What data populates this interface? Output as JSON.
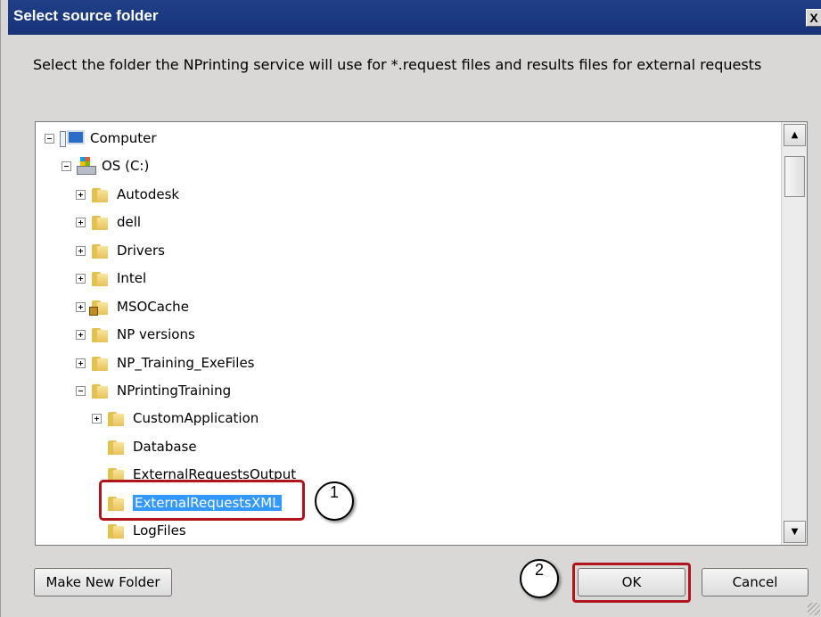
{
  "dialog": {
    "title": "Select source folder",
    "close_glyph": "X",
    "instruction": "Select the folder the NPrinting service will use for *.request files and results files for external requests"
  },
  "tree": {
    "computer": "Computer",
    "drive": "OS (C:)",
    "folders": {
      "autodesk": "Autodesk",
      "dell": "dell",
      "drivers": "Drivers",
      "intel": "Intel",
      "msocache": "MSOCache",
      "np_versions": "NP versions",
      "np_training_exefiles": "NP_Training_ExeFiles",
      "nprintingtraining": "NPrintingTraining",
      "customapplication": "CustomApplication",
      "database": "Database",
      "externalrequestsoutput": "ExternalRequestsOutput",
      "externalrequestsxml": "ExternalRequestsXML",
      "logfiles": "LogFiles"
    },
    "selected": "ExternalRequestsXML"
  },
  "callouts": {
    "one": "1",
    "two": "2"
  },
  "buttons": {
    "make_new_folder": "Make New Folder",
    "ok": "OK",
    "cancel": "Cancel"
  },
  "colors": {
    "titlebar": "#1f3f87",
    "selection": "#3399ff",
    "annotation_red": "#b0151c"
  }
}
